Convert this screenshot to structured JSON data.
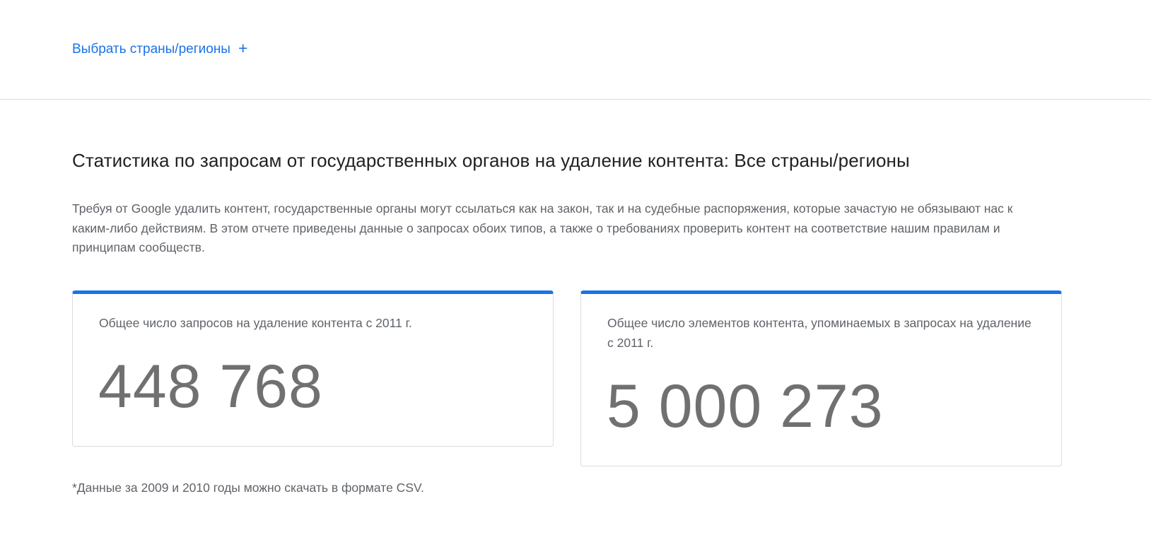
{
  "filter": {
    "select_label": "Выбрать страны/регионы",
    "plus_icon": "plus-icon"
  },
  "section": {
    "title": "Статистика по запросам от государственных органов на удаление контента: Все страны/регионы",
    "description": "Требуя от Google удалить контент, государственные органы могут ссылаться как на закон, так и на судебные распоряжения, которые зачастую не обязывают нас к каким-либо действиям. В этом отчете приведены данные о запросах обоих типов, а также о требованиях проверить контент на соответствие нашим правилам и принципам сообществ."
  },
  "cards": [
    {
      "label": "Общее число запросов на удаление контента с 2011 г.",
      "value": "448 768"
    },
    {
      "label": "Общее число элементов контента, упоминаемых в запросах на удаление с 2011 г.",
      "value": "5 000 273"
    }
  ],
  "footnote": "*Данные за 2009 и 2010 годы можно скачать в формате CSV.",
  "colors": {
    "accent": "#1a73e8",
    "border": "#dadce0",
    "muted_text": "#5f6368",
    "big_number": "#707070"
  }
}
